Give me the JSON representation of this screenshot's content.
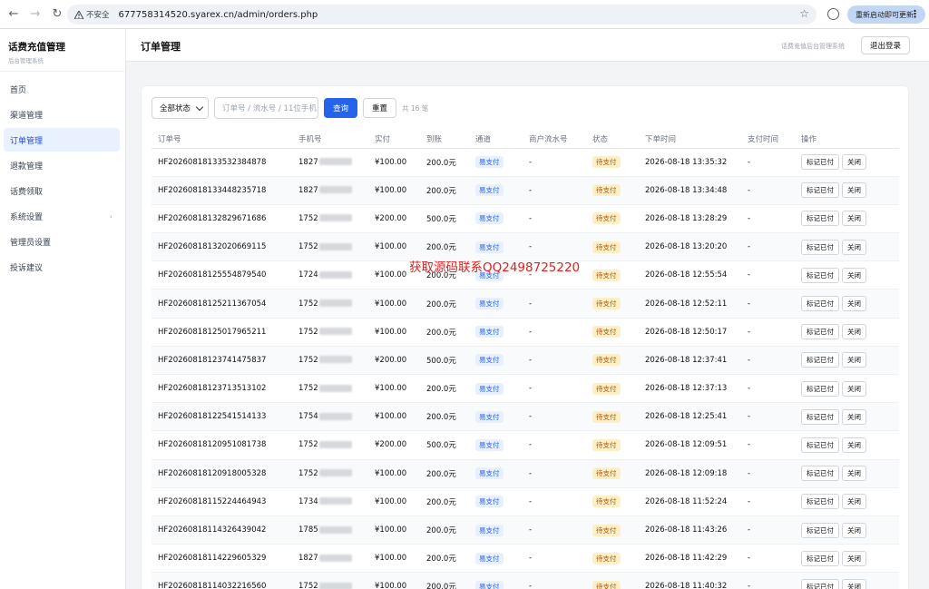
{
  "browser": {
    "insecure_label": "不安全",
    "url": "677758314520.syarex.cn/admin/orders.php",
    "update_label": "重新启动即可更新"
  },
  "sidebar": {
    "title": "话费充值管理",
    "subtitle": "后台管理系统",
    "items": [
      {
        "label": "首页"
      },
      {
        "label": "渠道管理"
      },
      {
        "label": "订单管理",
        "active": true
      },
      {
        "label": "退款管理"
      },
      {
        "label": "话费领取"
      },
      {
        "label": "系统设置",
        "chevron": "›"
      },
      {
        "label": "管理员设置"
      },
      {
        "label": "投诉建议"
      }
    ]
  },
  "header": {
    "title": "订单管理",
    "subtitle": "话费充值后台管理系统",
    "logout_label": "退出登录"
  },
  "filters": {
    "status_value": "全部状态",
    "search_placeholder": "订单号 / 流水号 / 11位手机",
    "query_label": "查询",
    "reset_label": "重置",
    "total_label": "共 16 笔"
  },
  "table": {
    "columns": [
      "订单号",
      "手机号",
      "实付",
      "到账",
      "通道",
      "商户流水号",
      "状态",
      "下单时间",
      "支付时间",
      "操作"
    ],
    "mark_paid_label": "标记已付",
    "close_label": "关闭",
    "rows": [
      {
        "order": "HF20260818133532384878",
        "phone": "1827",
        "paid": "¥100.00",
        "credit": "200.0元",
        "channel": "易支付",
        "merchant": "-",
        "status": "待支付",
        "created": "2026-08-18 13:35:32",
        "paytime": "-"
      },
      {
        "order": "HF20260818133448235718",
        "phone": "1827",
        "paid": "¥100.00",
        "credit": "200.0元",
        "channel": "易支付",
        "merchant": "-",
        "status": "待支付",
        "created": "2026-08-18 13:34:48",
        "paytime": "-"
      },
      {
        "order": "HF20260818132829671686",
        "phone": "1752",
        "paid": "¥200.00",
        "credit": "500.0元",
        "channel": "易支付",
        "merchant": "-",
        "status": "待支付",
        "created": "2026-08-18 13:28:29",
        "paytime": "-"
      },
      {
        "order": "HF20260818132020669115",
        "phone": "1752",
        "paid": "¥100.00",
        "credit": "200.0元",
        "channel": "易支付",
        "merchant": "-",
        "status": "待支付",
        "created": "2026-08-18 13:20:20",
        "paytime": "-"
      },
      {
        "order": "HF20260818125554879540",
        "phone": "1724",
        "paid": "¥100.00",
        "credit": "200.0元",
        "channel": "易支付",
        "merchant": "-",
        "status": "待支付",
        "created": "2026-08-18 12:55:54",
        "paytime": "-"
      },
      {
        "order": "HF20260818125211367054",
        "phone": "1752",
        "paid": "¥100.00",
        "credit": "200.0元",
        "channel": "易支付",
        "merchant": "-",
        "status": "待支付",
        "created": "2026-08-18 12:52:11",
        "paytime": "-"
      },
      {
        "order": "HF20260818125017965211",
        "phone": "1752",
        "paid": "¥100.00",
        "credit": "200.0元",
        "channel": "易支付",
        "merchant": "-",
        "status": "待支付",
        "created": "2026-08-18 12:50:17",
        "paytime": "-"
      },
      {
        "order": "HF20260818123741475837",
        "phone": "1752",
        "paid": "¥200.00",
        "credit": "500.0元",
        "channel": "易支付",
        "merchant": "-",
        "status": "待支付",
        "created": "2026-08-18 12:37:41",
        "paytime": "-"
      },
      {
        "order": "HF20260818123713513102",
        "phone": "1752",
        "paid": "¥100.00",
        "credit": "200.0元",
        "channel": "易支付",
        "merchant": "-",
        "status": "待支付",
        "created": "2026-08-18 12:37:13",
        "paytime": "-"
      },
      {
        "order": "HF20260818122541514133",
        "phone": "1754",
        "paid": "¥100.00",
        "credit": "200.0元",
        "channel": "易支付",
        "merchant": "-",
        "status": "待支付",
        "created": "2026-08-18 12:25:41",
        "paytime": "-"
      },
      {
        "order": "HF20260818120951081738",
        "phone": "1752",
        "paid": "¥200.00",
        "credit": "500.0元",
        "channel": "易支付",
        "merchant": "-",
        "status": "待支付",
        "created": "2026-08-18 12:09:51",
        "paytime": "-"
      },
      {
        "order": "HF20260818120918005328",
        "phone": "1752",
        "paid": "¥100.00",
        "credit": "200.0元",
        "channel": "易支付",
        "merchant": "-",
        "status": "待支付",
        "created": "2026-08-18 12:09:18",
        "paytime": "-"
      },
      {
        "order": "HF20260818115224464943",
        "phone": "1734",
        "paid": "¥100.00",
        "credit": "200.0元",
        "channel": "易支付",
        "merchant": "-",
        "status": "待支付",
        "created": "2026-08-18 11:52:24",
        "paytime": "-"
      },
      {
        "order": "HF20260818114326439042",
        "phone": "1785",
        "paid": "¥100.00",
        "credit": "200.0元",
        "channel": "易支付",
        "merchant": "-",
        "status": "待支付",
        "created": "2026-08-18 11:43:26",
        "paytime": "-"
      },
      {
        "order": "HF20260818114229605329",
        "phone": "1827",
        "paid": "¥100.00",
        "credit": "200.0元",
        "channel": "易支付",
        "merchant": "-",
        "status": "待支付",
        "created": "2026-08-18 11:42:29",
        "paytime": "-"
      },
      {
        "order": "HF20260818114032216560",
        "phone": "1752",
        "paid": "¥100.00",
        "credit": "200.0元",
        "channel": "易支付",
        "merchant": "-",
        "status": "待支付",
        "created": "2026-08-18 11:40:32",
        "paytime": "-"
      }
    ]
  },
  "watermark": "获取源码联系QQ2498725220",
  "colors": {
    "accent": "#2563eb",
    "pending_bg": "#fdf0c7",
    "pending_text": "#b45309",
    "watermark": "#e11d1d"
  }
}
